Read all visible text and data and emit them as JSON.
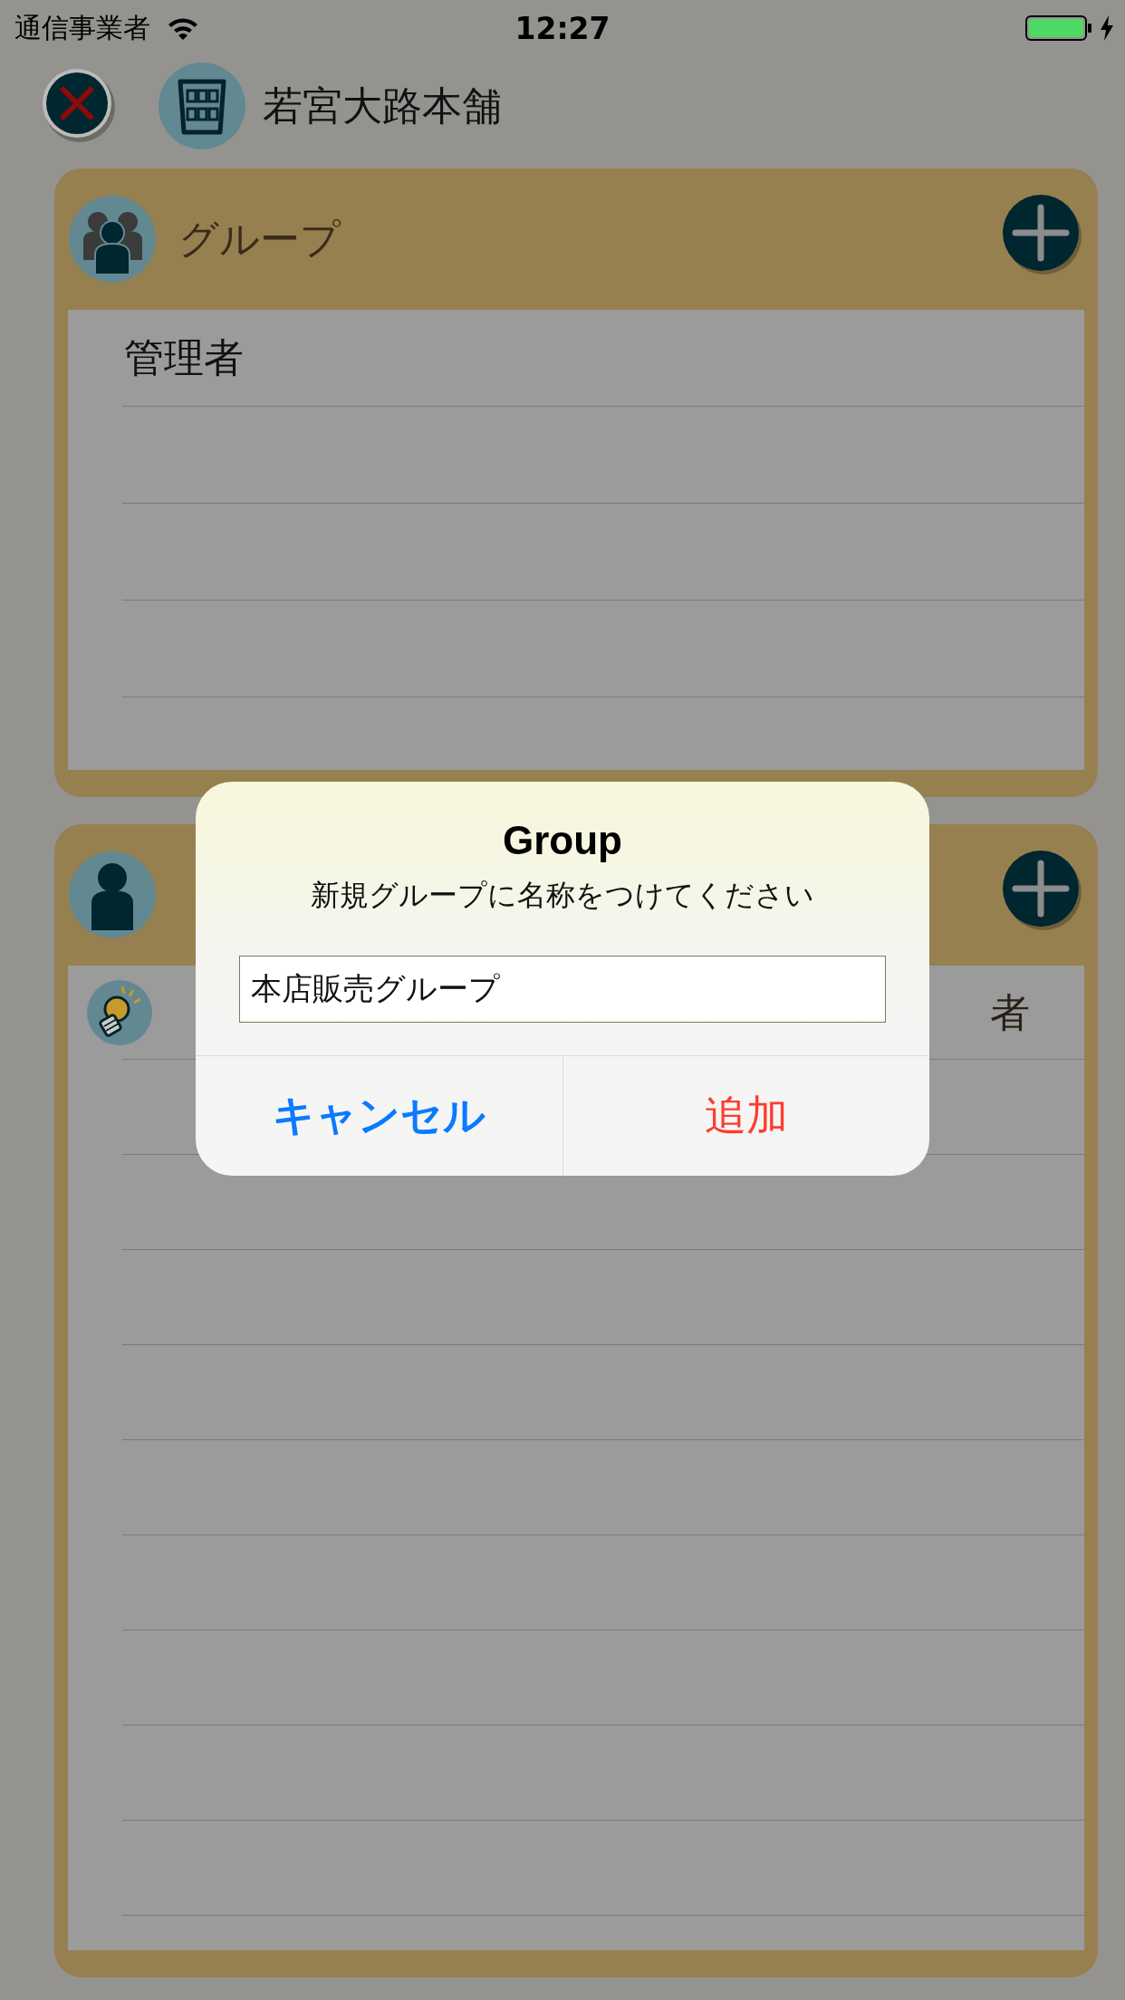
{
  "status_bar": {
    "carrier": "通信事業者",
    "time": "12:27"
  },
  "header": {
    "title": "若宮大路本舗"
  },
  "cards": [
    {
      "kind": "group",
      "title": "グループ",
      "rows": [
        {
          "kind": "text",
          "text": "管理者"
        },
        {
          "kind": "blank"
        },
        {
          "kind": "blank"
        },
        {
          "kind": "blank"
        }
      ]
    },
    {
      "kind": "person",
      "rows": [
        {
          "kind": "partial",
          "text": "者"
        },
        {
          "kind": "blank"
        },
        {
          "kind": "blank"
        },
        {
          "kind": "blank"
        },
        {
          "kind": "blank"
        },
        {
          "kind": "blank"
        },
        {
          "kind": "blank"
        },
        {
          "kind": "blank"
        },
        {
          "kind": "blank"
        },
        {
          "kind": "blank"
        }
      ]
    }
  ],
  "dialog": {
    "title": "Group",
    "message": "新規グループに名称をつけてください",
    "field": {
      "value": "本店販売グループ"
    },
    "buttons": [
      {
        "kind": "cancel",
        "label": "キャンセル"
      },
      {
        "kind": "default",
        "label": "追加"
      }
    ]
  }
}
